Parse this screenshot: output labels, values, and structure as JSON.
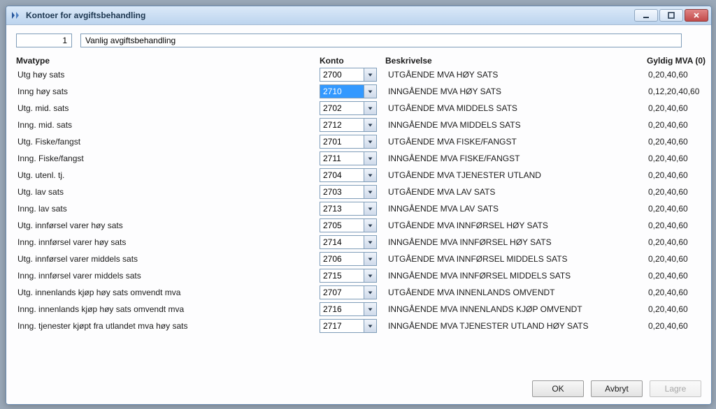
{
  "window": {
    "title": "Kontoer for avgiftsbehandling"
  },
  "header": {
    "code": "1",
    "name": "Vanlig avgiftsbehandling"
  },
  "columns": {
    "type": "Mvatype",
    "konto": "Konto",
    "desc": "Beskrivelse",
    "valid": "Gyldig MVA (0)"
  },
  "rows": [
    {
      "type": "Utg høy sats",
      "konto": "2700",
      "desc": "UTGÅENDE MVA HØY SATS",
      "valid": "0,20,40,60",
      "selected": false
    },
    {
      "type": "Inng høy sats",
      "konto": "2710",
      "desc": "INNGÅENDE MVA HØY SATS",
      "valid": "0,12,20,40,60",
      "selected": true
    },
    {
      "type": "Utg. mid. sats",
      "konto": "2702",
      "desc": "UTGÅENDE MVA MIDDELS SATS",
      "valid": "0,20,40,60",
      "selected": false
    },
    {
      "type": "Inng. mid. sats",
      "konto": "2712",
      "desc": "INNGÅENDE MVA MIDDELS SATS",
      "valid": "0,20,40,60",
      "selected": false
    },
    {
      "type": "Utg. Fiske/fangst",
      "konto": "2701",
      "desc": "UTGÅENDE MVA FISKE/FANGST",
      "valid": "0,20,40,60",
      "selected": false
    },
    {
      "type": "Inng. Fiske/fangst",
      "konto": "2711",
      "desc": "INNGÅENDE MVA FISKE/FANGST",
      "valid": "0,20,40,60",
      "selected": false
    },
    {
      "type": "Utg. utenl. tj.",
      "konto": "2704",
      "desc": "UTGÅENDE MVA TJENESTER UTLAND",
      "valid": "0,20,40,60",
      "selected": false
    },
    {
      "type": "Utg. lav sats",
      "konto": "2703",
      "desc": "UTGÅENDE MVA LAV SATS",
      "valid": "0,20,40,60",
      "selected": false
    },
    {
      "type": "Inng. lav sats",
      "konto": "2713",
      "desc": "INNGÅENDE MVA LAV SATS",
      "valid": "0,20,40,60",
      "selected": false
    },
    {
      "type": "Utg. innførsel varer høy sats",
      "konto": "2705",
      "desc": "UTGÅENDE MVA INNFØRSEL HØY SATS",
      "valid": "0,20,40,60",
      "selected": false
    },
    {
      "type": "Inng. innførsel varer høy sats",
      "konto": "2714",
      "desc": "INNGÅENDE MVA INNFØRSEL HØY SATS",
      "valid": "0,20,40,60",
      "selected": false
    },
    {
      "type": "Utg. innførsel varer middels sats",
      "konto": "2706",
      "desc": "UTGÅENDE MVA INNFØRSEL MIDDELS SATS",
      "valid": "0,20,40,60",
      "selected": false
    },
    {
      "type": "Inng. innførsel varer middels sats",
      "konto": "2715",
      "desc": "INNGÅENDE MVA INNFØRSEL MIDDELS SATS",
      "valid": "0,20,40,60",
      "selected": false
    },
    {
      "type": "Utg. innenlands kjøp høy sats omvendt mva",
      "konto": "2707",
      "desc": "UTGÅENDE MVA INNENLANDS OMVENDT",
      "valid": "0,20,40,60",
      "selected": false
    },
    {
      "type": "Inng. innenlands kjøp høy sats omvendt mva",
      "konto": "2716",
      "desc": "INNGÅENDE MVA INNENLANDS KJØP OMVENDT",
      "valid": "0,20,40,60",
      "selected": false
    },
    {
      "type": "Inng. tjenester kjøpt fra utlandet mva høy sats",
      "konto": "2717",
      "desc": "INNGÅENDE MVA TJENESTER UTLAND HØY SATS",
      "valid": "0,20,40,60",
      "selected": false
    }
  ],
  "buttons": {
    "ok": "OK",
    "cancel": "Avbryt",
    "save": "Lagre"
  }
}
